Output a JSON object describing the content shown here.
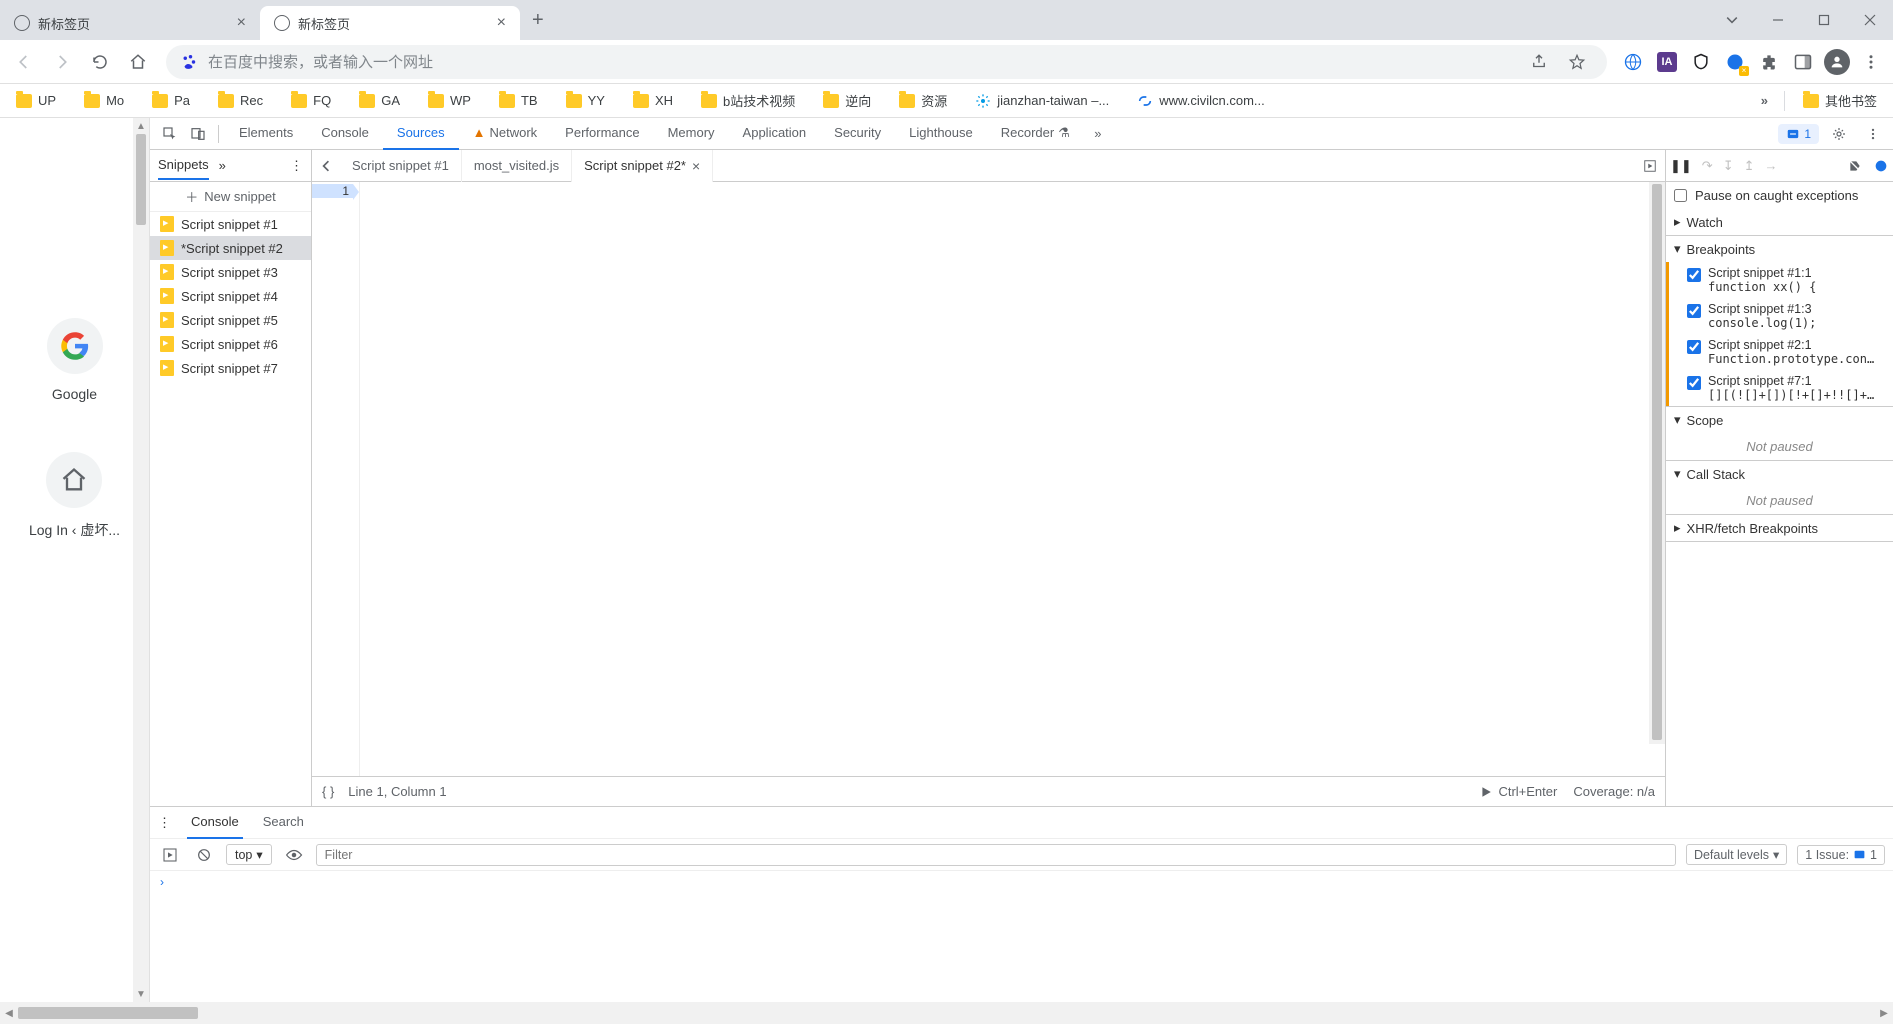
{
  "window": {
    "tabs": [
      {
        "title": "新标签页",
        "active": false
      },
      {
        "title": "新标签页",
        "active": true
      }
    ]
  },
  "toolbar": {
    "omnibox_placeholder": "在百度中搜索，或者输入一个网址"
  },
  "bookmarks": {
    "items": [
      {
        "label": "UP",
        "type": "folder"
      },
      {
        "label": "Mo",
        "type": "folder"
      },
      {
        "label": "Pa",
        "type": "folder"
      },
      {
        "label": "Rec",
        "type": "folder"
      },
      {
        "label": "FQ",
        "type": "folder"
      },
      {
        "label": "GA",
        "type": "folder"
      },
      {
        "label": "WP",
        "type": "folder"
      },
      {
        "label": "TB",
        "type": "folder"
      },
      {
        "label": "YY",
        "type": "folder"
      },
      {
        "label": "XH",
        "type": "folder"
      },
      {
        "label": "b站技术视频",
        "type": "folder"
      },
      {
        "label": "逆向",
        "type": "folder"
      },
      {
        "label": "资源",
        "type": "folder"
      },
      {
        "label": "jianzhan-taiwan –...",
        "type": "link-gear"
      },
      {
        "label": "www.civilcn.com...",
        "type": "link-blue"
      }
    ],
    "other_label": "其他书签"
  },
  "ntp": {
    "shortcuts": [
      {
        "label": "Google",
        "icon": "google"
      },
      {
        "label": "Log In ‹ 虚坏...",
        "icon": "home"
      }
    ]
  },
  "devtools": {
    "tabs": [
      "Elements",
      "Console",
      "Sources",
      "Network",
      "Performance",
      "Memory",
      "Application",
      "Security",
      "Lighthouse",
      "Recorder"
    ],
    "active_tab": "Sources",
    "network_has_warning": true,
    "recorder_has_flask": true,
    "issues_count": "1"
  },
  "snippets": {
    "header": "Snippets",
    "new_label": "New snippet",
    "items": [
      {
        "label": "Script snippet #1",
        "modified": false
      },
      {
        "label": "*Script snippet #2",
        "modified": true,
        "active": true
      },
      {
        "label": "Script snippet #3",
        "modified": false
      },
      {
        "label": "Script snippet #4",
        "modified": false
      },
      {
        "label": "Script snippet #5",
        "modified": false
      },
      {
        "label": "Script snippet #6",
        "modified": false
      },
      {
        "label": "Script snippet #7",
        "modified": false
      }
    ]
  },
  "editor": {
    "open_tabs": [
      {
        "label": "Script snippet #1",
        "active": false,
        "closeable": false
      },
      {
        "label": "most_visited.js",
        "active": false,
        "closeable": false
      },
      {
        "label": "Script snippet #2*",
        "active": true,
        "closeable": true
      }
    ],
    "line_number": "1",
    "status_pos": "Line 1, Column 1",
    "run_hint": "Ctrl+Enter",
    "coverage": "Coverage: n/a"
  },
  "debugger": {
    "pause_checkbox_label": "Pause on caught exceptions",
    "sections": {
      "watch": "Watch",
      "breakpoints": "Breakpoints",
      "scope": "Scope",
      "callstack": "Call Stack",
      "xhr": "XHR/fetch Breakpoints"
    },
    "breakpoints": [
      {
        "title": "Script snippet #1:1",
        "code": "function xx() {"
      },
      {
        "title": "Script snippet #1:3",
        "code": "console.log(1);"
      },
      {
        "title": "Script snippet #2:1",
        "code": "Function.prototype.con…"
      },
      {
        "title": "Script snippet #7:1",
        "code": "[][(![]+[])[!+[]+!![]+…"
      }
    ],
    "not_paused": "Not paused"
  },
  "console": {
    "tabs": {
      "console": "Console",
      "search": "Search"
    },
    "context": "top",
    "filter_placeholder": "Filter",
    "levels": "Default levels",
    "issue_label": "1 Issue:",
    "issue_count": "1"
  }
}
